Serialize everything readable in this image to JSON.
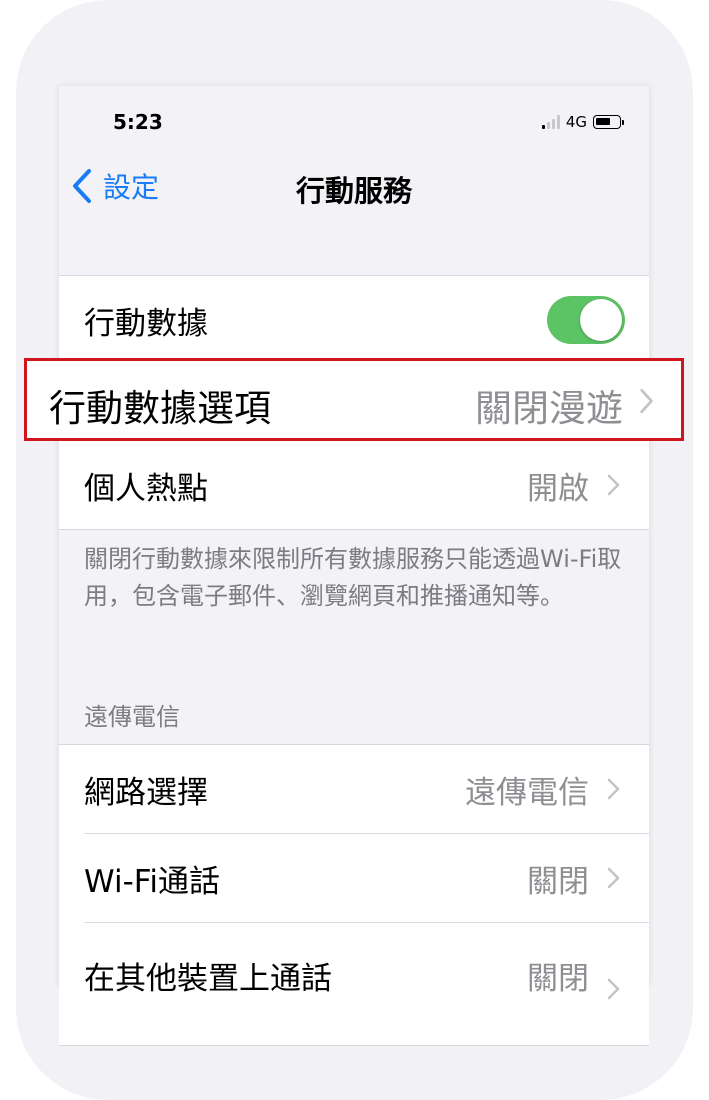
{
  "status_bar": {
    "time": "5:23",
    "network": "4G"
  },
  "nav": {
    "back_label": "設定",
    "title": "行動服務"
  },
  "section1": {
    "mobile_data_label": "行動數據",
    "mobile_data_enabled": true,
    "mobile_data_options_label": "行動數據選項",
    "mobile_data_options_value": "關閉漫遊",
    "hotspot_label": "個人熱點",
    "hotspot_value": "開啟"
  },
  "footnote": "關閉行動數據來限制所有數據服務只能透過Wi-Fi取用，包含電子郵件、瀏覽網頁和推播通知等。",
  "carrier_section": {
    "header": "遠傳電信",
    "network_selection_label": "網路選擇",
    "network_selection_value": "遠傳電信",
    "wifi_calling_label": "Wi-Fi通話",
    "wifi_calling_value": "關閉",
    "other_devices_label": "在其他裝置上通話",
    "other_devices_value": "關閉"
  },
  "colors": {
    "accent": "#1a7cf4",
    "toggle_on": "#5dc466",
    "highlight": "#d2141c",
    "secondary_text": "#8e8e93"
  }
}
